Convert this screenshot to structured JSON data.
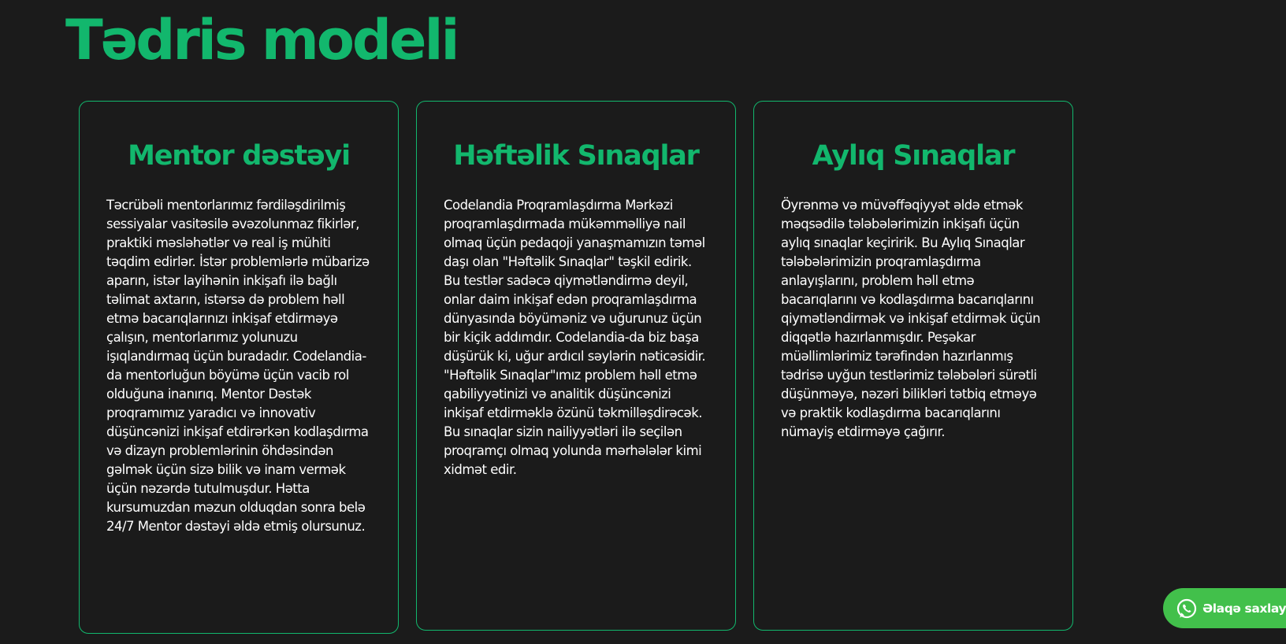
{
  "section": {
    "title": "Tədris modeli"
  },
  "cards": [
    {
      "title": "Mentor dəstəyi",
      "text": "Təcrübəli mentorlarımız fərdiləşdirilmiş sessiyalar vasitəsilə əvəzolunmaz fikirlər, praktiki məsləhətlər və real iş mühiti təqdim edirlər. İstər problemlərlə mübarizə aparın, istər layihənin inkişafı ilə bağlı təlimat axtarın, istərsə də problem həll etmə bacarıqlarınızı inkişaf etdirməyə çalışın, mentorlarımız yolunuzu işıqlandırmaq üçün buradadır. Codelandia-da mentorluğun böyümə üçün vacib rol olduğuna inanırıq. Mentor Dəstək proqramımız yaradıcı və innovativ düşüncənizi inkişaf etdirərkən kodlaşdırma və dizayn problemlərinin öhdəsindən gəlmək üçün sizə bilik və inam vermək üçün nəzərdə tutulmuşdur. Hətta kursumuzdan məzun olduqdan sonra belə 24/7 Mentor dəstəyi əldə etmiş olursunuz."
    },
    {
      "title": "Həftəlik Sınaqlar",
      "text": "Codelandia Proqramlaşdırma Mərkəzi proqramlaşdırmada mükəmməlliyə nail olmaq üçün pedaqoji yanaşmamızın təməl daşı olan \"Həftəlik Sınaqlar\" təşkil edirik. Bu testlər sadəcə qiymətləndirmə deyil, onlar daim inkişaf edən proqramlaşdırma dünyasında böyüməniz və uğurunuz üçün bir kiçik addımdır. Codelandia-da biz başa düşürük ki, uğur ardıcıl səylərin nəticəsidir. \"Həftəlik Sınaqlar\"ımız problem həll etmə qabiliyyətinizi və analitik düşüncənizi inkişaf etdirməklə özünü təkmilləşdirəcək. Bu sınaqlar sizin nailiyyətləri ilə seçilən proqramçı olmaq yolunda mərhələlər kimi xidmət edir."
    },
    {
      "title": "Aylıq Sınaqlar",
      "text": "Öyrənmə və müvəffəqiyyət əldə etmək məqsədilə tələbələrimizin inkişafı üçün aylıq sınaqlar keçiririk. Bu Aylıq Sınaqlar tələbələrimizin proqramlaşdırma anlayışlarını, problem həll etmə bacarıqlarını və kodlaşdırma bacarıqlarını qiymətləndirmək və inkişaf etdirmək üçün diqqətlə hazırlanmışdır. Peşəkar müəllimlərimiz tərəfindən hazırlanmış tədrisə uyğun testlərimiz tələbələri sürətli düşünməyə, nəzəri bilikləri tətbiq etməyə və praktik kodlaşdırma bacarıqlarını nümayiş etdirməyə çağırır."
    }
  ],
  "whatsapp": {
    "label": "Əlaqə saxlayın",
    "icon": "whatsapp-icon",
    "color": "#42c04b"
  },
  "colors": {
    "background": "#1b1b1b",
    "accent": "#12b76d",
    "text": "#ffffff"
  }
}
